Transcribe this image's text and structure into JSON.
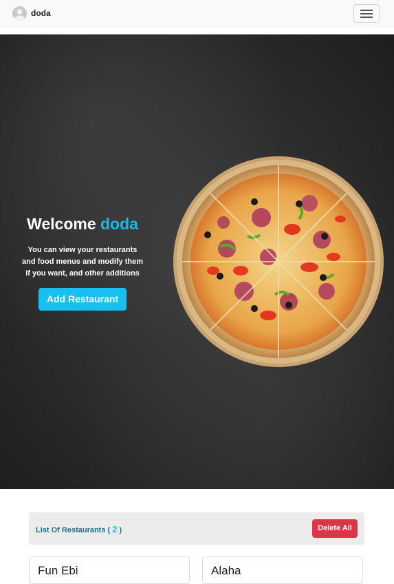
{
  "navbar": {
    "username": "doda",
    "avatar_icon": "user-avatar-icon",
    "menu_icon": "hamburger-menu-icon"
  },
  "hero": {
    "welcome": "Welcome",
    "name": "doda",
    "description": "You can view your restaurants and food menus and modify them if you want, and other additions",
    "add_button": "Add Restaurant",
    "image": "pizza-image"
  },
  "restaurants": {
    "list_label": "List Of Restaurants (",
    "count": "2",
    "list_label_end": ")",
    "delete_all": "Delete All",
    "cards": [
      {
        "title": "Fun Ebi"
      },
      {
        "title": "Alaha"
      }
    ]
  },
  "colors": {
    "accent": "#1ab7ea",
    "button": "#17c0ee",
    "danger": "#dc3545"
  }
}
